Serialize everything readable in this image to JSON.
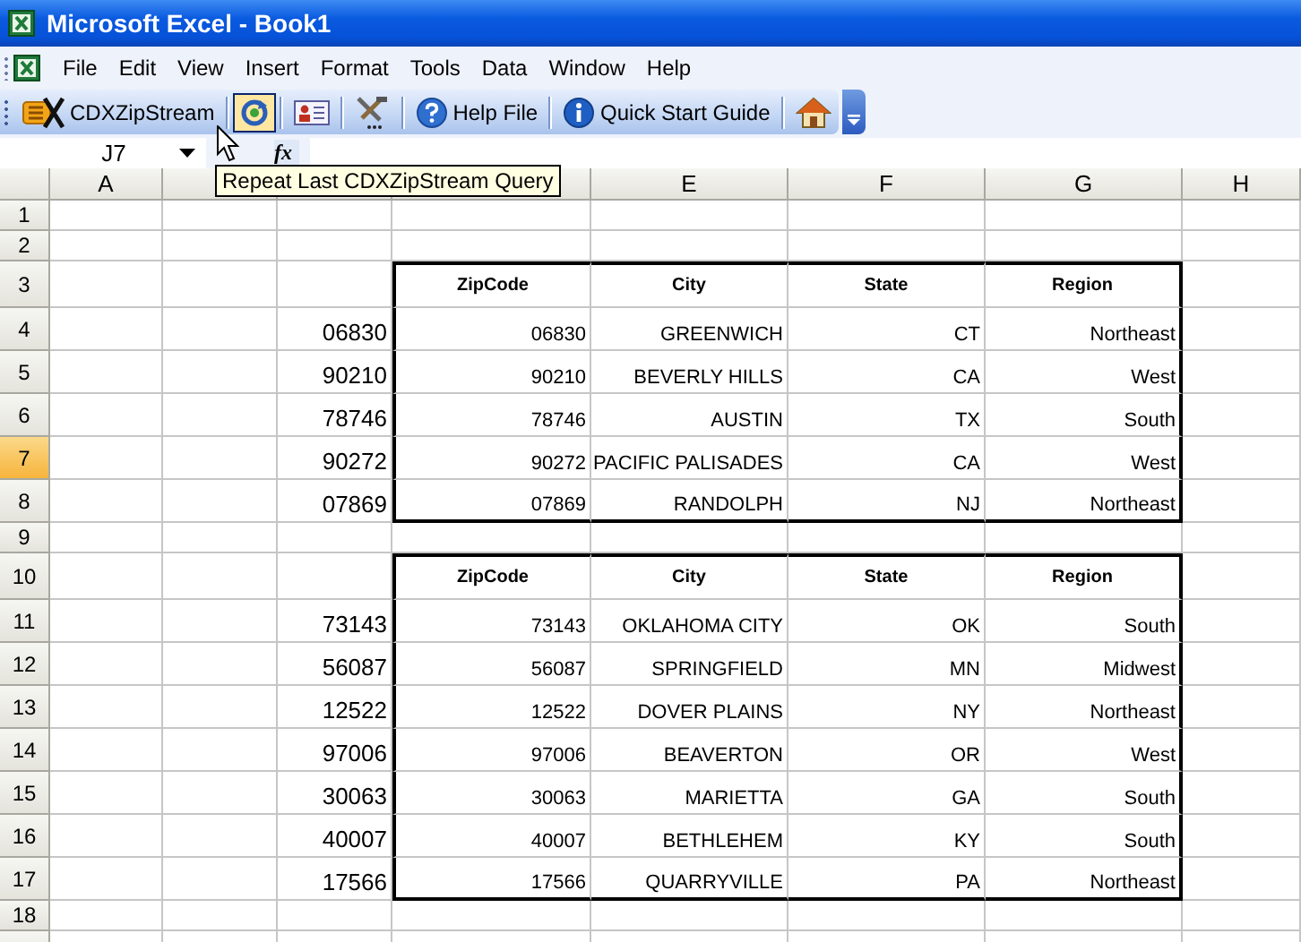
{
  "window": {
    "title": "Microsoft Excel - Book1"
  },
  "menu": [
    "File",
    "Edit",
    "View",
    "Insert",
    "Format",
    "Tools",
    "Data",
    "Window",
    "Help"
  ],
  "toolbar": [
    {
      "kind": "text",
      "label": "CDXZipStream",
      "hovered": false
    },
    {
      "kind": "icon",
      "hovered": true
    },
    {
      "kind": "icon",
      "hovered": false
    },
    {
      "kind": "icon",
      "hovered": false
    },
    {
      "kind": "text",
      "label": "Help File",
      "hovered": false
    },
    {
      "kind": "text",
      "label": "Quick Start Guide",
      "hovered": false
    },
    {
      "kind": "icon",
      "hovered": false
    }
  ],
  "formula_bar": {
    "name_box": "J7",
    "function_label": "fx"
  },
  "tooltip": "Repeat Last CDXZipStream Query",
  "sheet": {
    "columns": [
      {
        "label": "A"
      },
      {},
      {},
      {},
      {
        "label": "E"
      },
      {
        "label": "F"
      },
      {
        "label": "G"
      },
      {
        "label": "H"
      }
    ],
    "rows": [
      {
        "number": "1",
        "selected": false,
        "kind": "blank"
      },
      {
        "number": "2",
        "selected": false,
        "kind": "blank"
      },
      {
        "number": "3",
        "selected": false,
        "kind": "header",
        "values": [
          "ZipCode",
          "City",
          "State",
          "Region"
        ]
      },
      {
        "number": "4",
        "selected": false,
        "kind": "record",
        "lookup": "06830",
        "values": [
          "06830",
          "GREENWICH",
          "CT",
          "Northeast"
        ]
      },
      {
        "number": "5",
        "selected": false,
        "kind": "record",
        "lookup": "90210",
        "values": [
          "90210",
          "BEVERLY HILLS",
          "CA",
          "West"
        ]
      },
      {
        "number": "6",
        "selected": false,
        "kind": "record",
        "lookup": "78746",
        "values": [
          "78746",
          "AUSTIN",
          "TX",
          "South"
        ]
      },
      {
        "number": "7",
        "selected": true,
        "kind": "record",
        "lookup": "90272",
        "values": [
          "90272",
          "PACIFIC PALISADES",
          "CA",
          "West"
        ]
      },
      {
        "number": "8",
        "selected": false,
        "kind": "record",
        "lookup": "07869",
        "values": [
          "07869",
          "RANDOLPH",
          "NJ",
          "Northeast"
        ]
      },
      {
        "number": "9",
        "selected": false,
        "kind": "blank"
      },
      {
        "number": "10",
        "selected": false,
        "kind": "header",
        "values": [
          "ZipCode",
          "City",
          "State",
          "Region"
        ]
      },
      {
        "number": "11",
        "selected": false,
        "kind": "record",
        "lookup": "73143",
        "values": [
          "73143",
          "OKLAHOMA CITY",
          "OK",
          "South"
        ]
      },
      {
        "number": "12",
        "selected": false,
        "kind": "record",
        "lookup": "56087",
        "values": [
          "56087",
          "SPRINGFIELD",
          "MN",
          "Midwest"
        ]
      },
      {
        "number": "13",
        "selected": false,
        "kind": "record",
        "lookup": "12522",
        "values": [
          "12522",
          "DOVER PLAINS",
          "NY",
          "Northeast"
        ]
      },
      {
        "number": "14",
        "selected": false,
        "kind": "record",
        "lookup": "97006",
        "values": [
          "97006",
          "BEAVERTON",
          "OR",
          "West"
        ]
      },
      {
        "number": "15",
        "selected": false,
        "kind": "record",
        "lookup": "30063",
        "values": [
          "30063",
          "MARIETTA",
          "GA",
          "South"
        ]
      },
      {
        "number": "16",
        "selected": false,
        "kind": "record",
        "lookup": "40007",
        "values": [
          "40007",
          "BETHLEHEM",
          "KY",
          "South"
        ]
      },
      {
        "number": "17",
        "selected": false,
        "kind": "record",
        "lookup": "17566",
        "values": [
          "17566",
          "QUARRYVILLE",
          "PA",
          "Northeast"
        ]
      },
      {
        "number": "18",
        "selected": false,
        "kind": "blank"
      }
    ]
  }
}
